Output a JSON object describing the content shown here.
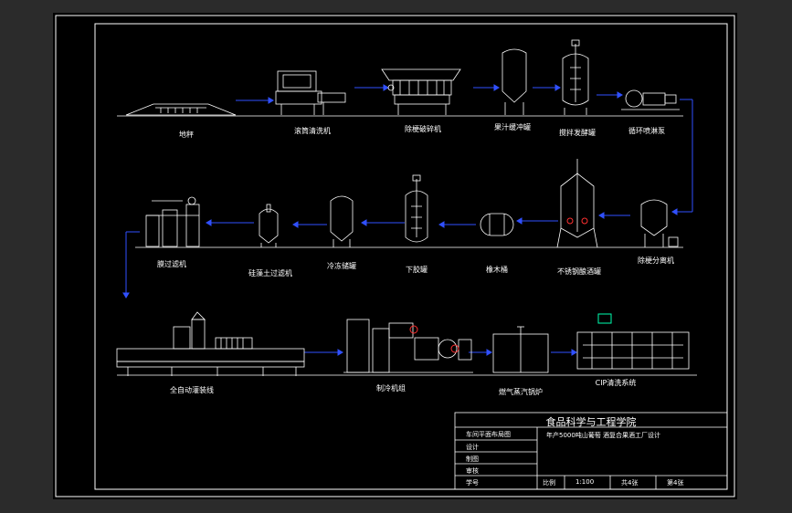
{
  "colors": {
    "background": "#000000",
    "frame": "#ffffff",
    "flow": "#3050ff",
    "accent_green": "#00ffb0",
    "accent_red": "#ff3030"
  },
  "row1": [
    "地秤",
    "滚筒清洗机",
    "除梗破碎机",
    "果汁缓冲罐",
    "搅拌发酵罐",
    "循环喷淋泵"
  ],
  "row2": [
    "膜过滤机",
    "硅藻土过滤机",
    "冷冻储罐",
    "下胶罐",
    "橡木桶",
    "不锈钢酿酒罐",
    "除梗分离机"
  ],
  "row3": [
    "全自动灌装线",
    "制冷机组",
    "燃气蒸汽锅炉",
    "CIP清洗系统"
  ],
  "title_block": {
    "school": "食品科学与工程学院",
    "drawing_name": "车间平面布局图",
    "project": "年产5000吨山葡萄 酒复合果酒工厂设计",
    "rows": [
      "设计",
      "制图",
      "审核",
      "学号"
    ],
    "bottom_cells": [
      "比例",
      "1:100",
      "共4张",
      "第4张"
    ]
  }
}
